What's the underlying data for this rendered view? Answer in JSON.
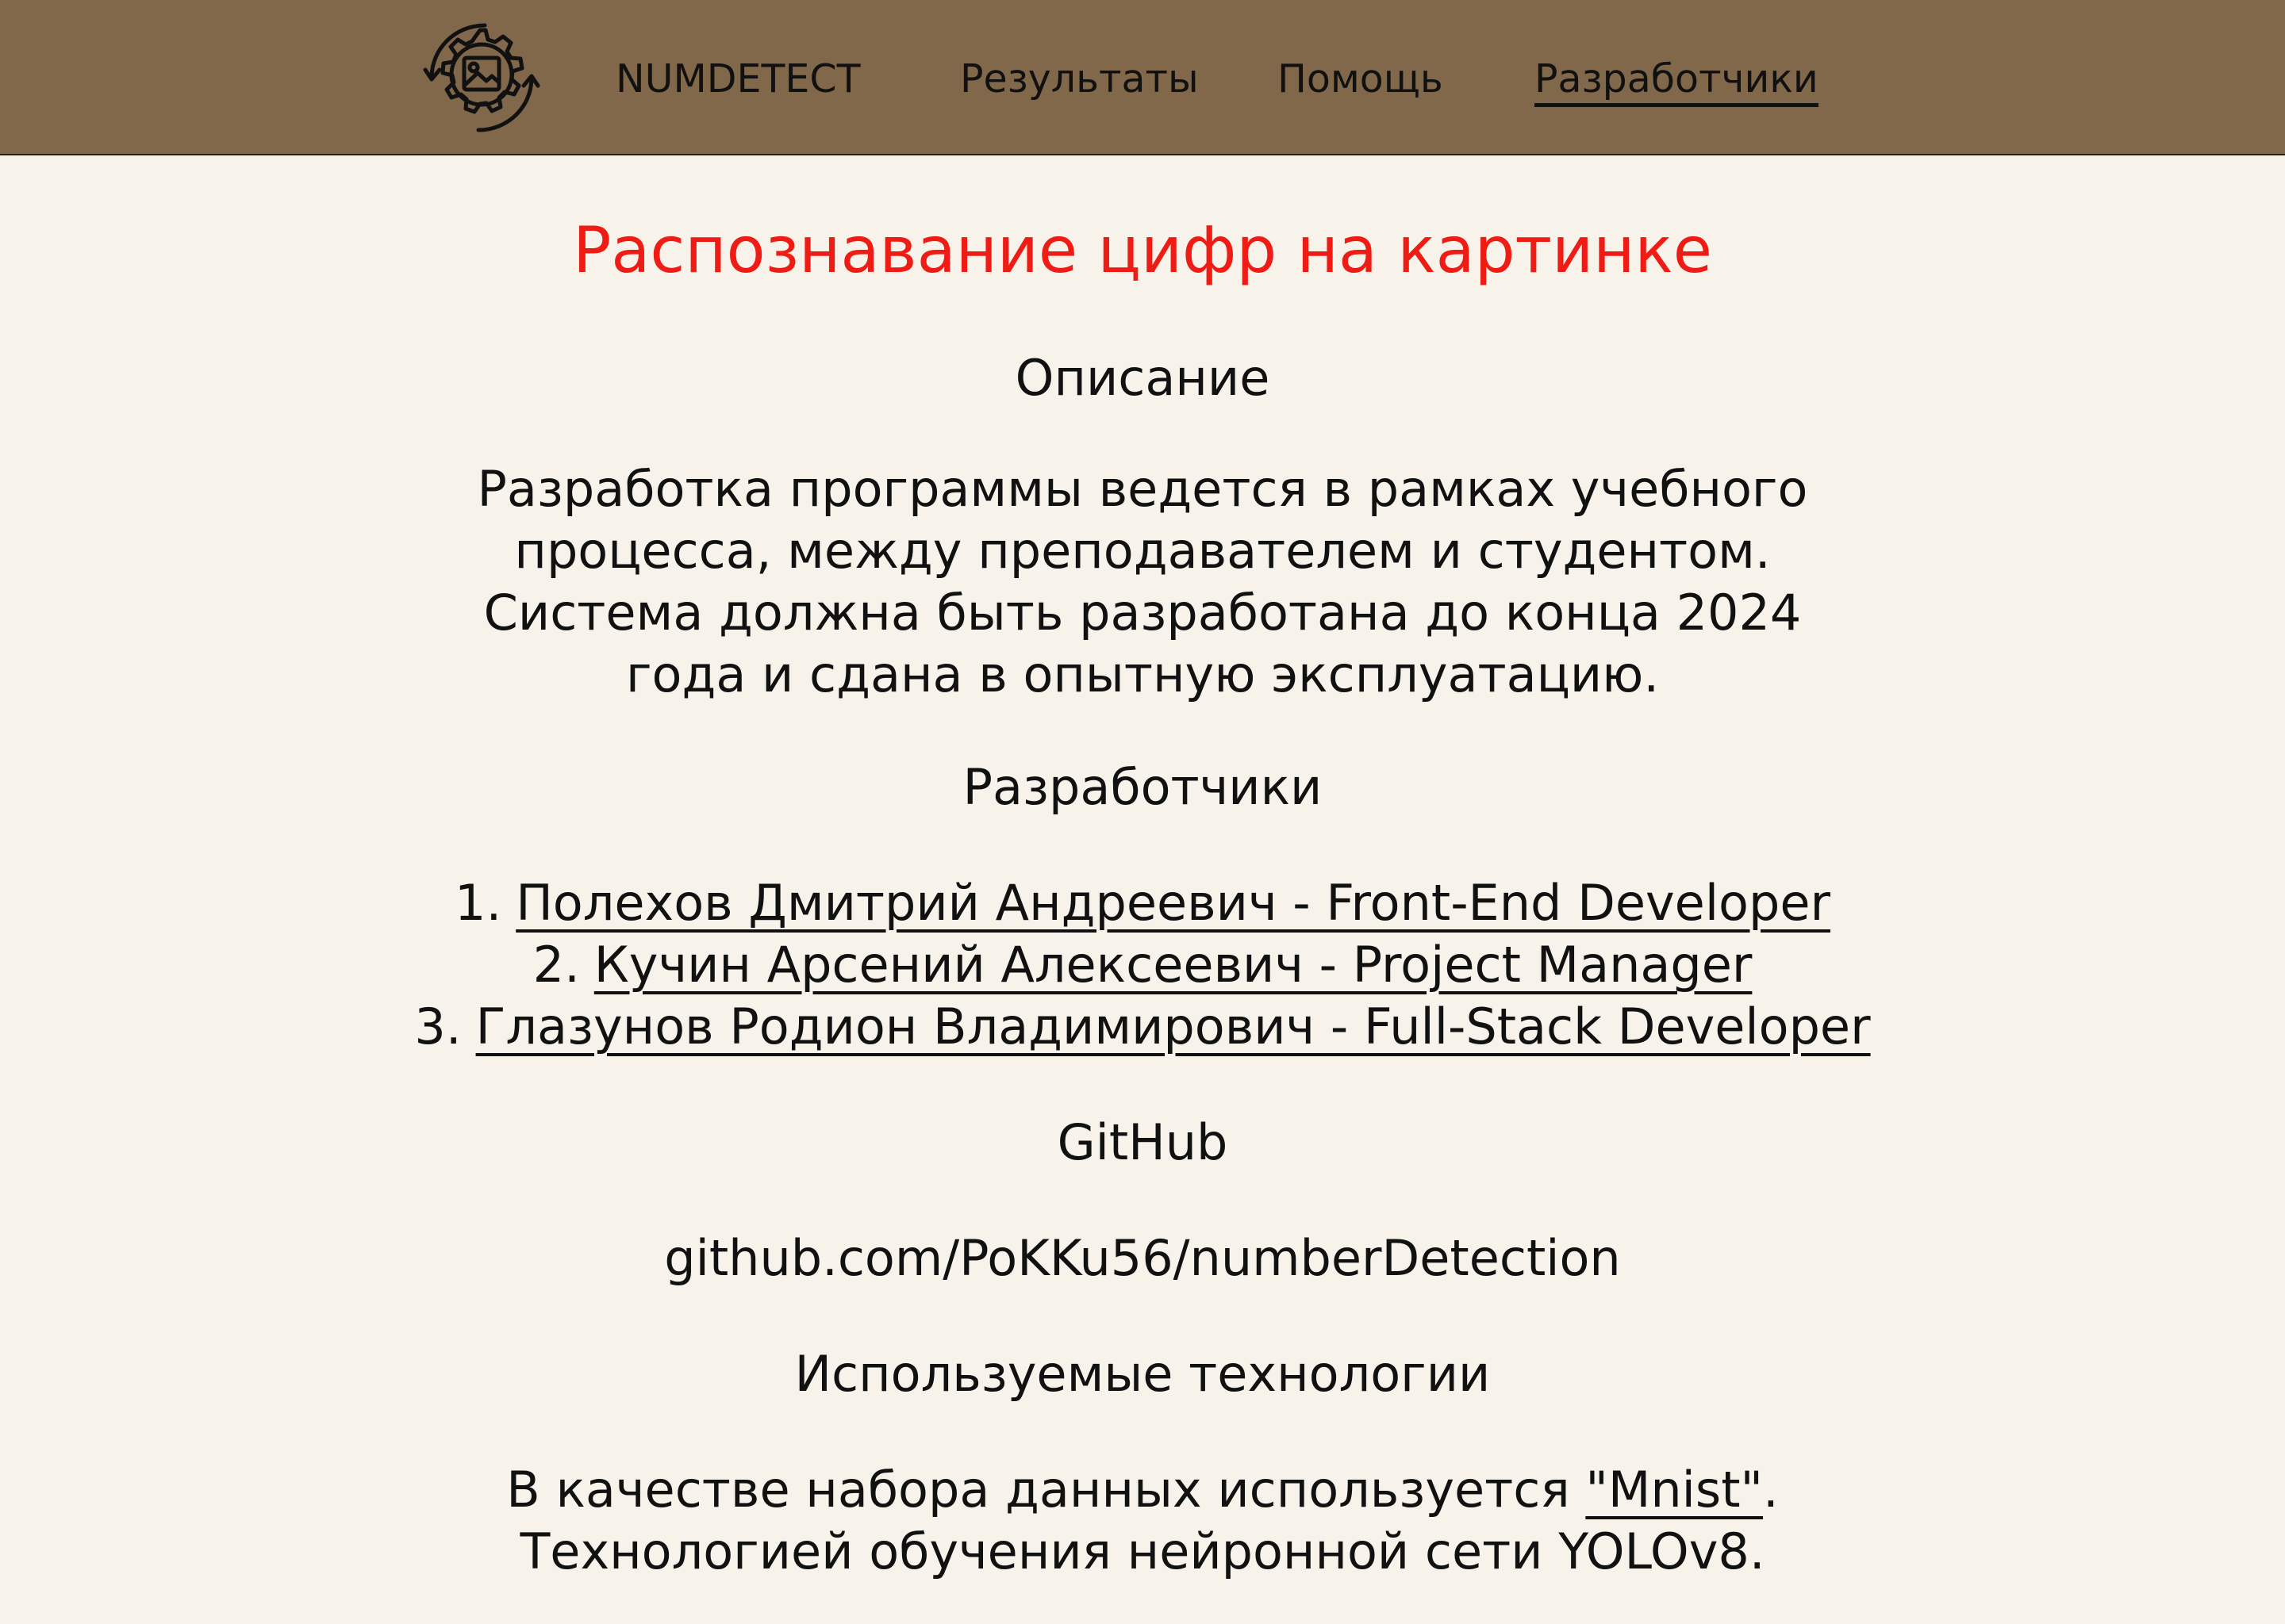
{
  "header": {
    "logo_icon": "gear-image-icon",
    "nav": {
      "brand": "NUMDETECT",
      "results": "Результаты",
      "help": "Помощь",
      "developers": "Разработчики"
    },
    "active_item": "developers"
  },
  "main": {
    "title": "Распознавание цифр на картинке",
    "description_heading": "Описание",
    "description_lines": [
      "Разработка программы ведется в рамках учебного",
      "процесса, между преподавателем и студентом.",
      "Система должна быть разработана до конца 2024",
      "года и сдана в опытную эксплуатацию."
    ],
    "developers_heading": "Разработчики",
    "developers": [
      {
        "num": "1.",
        "text": "Полехов Дмитрий Андреевич - Front-End Developer"
      },
      {
        "num": "2.",
        "text": "Кучин Арсений Алексеевич - Project Manager"
      },
      {
        "num": "3.",
        "text": "Глазунов Родион Владимирович - Full-Stack Developer"
      }
    ],
    "github_heading": "GitHub",
    "github_link": "github.com/PoKKu56/numberDetection",
    "tech_heading": "Используемые технологии",
    "tech_line1_prefix": "В качестве набора данных используется ",
    "tech_dataset_link": "\"Mnist\"",
    "tech_line1_suffix": ".",
    "tech_line2": "Технологией обучения нейронной сети YOLOv8."
  },
  "colors": {
    "header_bg": "#81684b",
    "page_bg": "#f7f3ea",
    "title": "#ee1c14",
    "text": "#111111"
  }
}
